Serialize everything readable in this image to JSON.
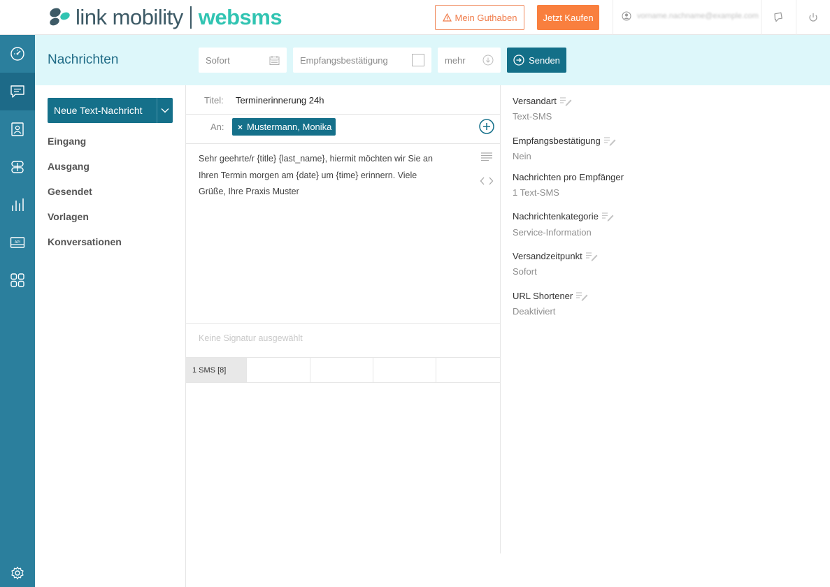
{
  "header": {
    "logo_text": "link mobility",
    "logo_brand": "websms",
    "guthaben_label": "Mein Guthaben",
    "kaufen_label": "Jetzt Kaufen",
    "user_name": "vorname.nachname@example.com"
  },
  "rail": {
    "items": [
      "dashboard-icon",
      "messages-icon",
      "contacts-icon",
      "integrations-icon",
      "statistics-icon",
      "api-icon",
      "apps-icon"
    ],
    "settings_icon": "settings-icon"
  },
  "section": {
    "title": "Nachrichten"
  },
  "toolbar": {
    "schedule_value": "Sofort",
    "receipt_label": "Empfangsbestätigung",
    "more_label": "mehr",
    "send_label": "Senden"
  },
  "sidenav": {
    "new_message_label": "Neue Text-Nachricht",
    "items": [
      "Eingang",
      "Ausgang",
      "Gesendet",
      "Vorlagen",
      "Konversationen"
    ]
  },
  "compose": {
    "title_label": "Titel:",
    "title_value": "Terminerinnerung 24h",
    "to_label": "An:",
    "recipient": "Mustermann, Monika",
    "body_lines": [
      "Sehr geehrte/r {title} {last_name}, hiermit möchten wir Sie an",
      "Ihren Termin morgen am {date} um {time} erinnern. Viele",
      "Grüße, Ihre Praxis Muster"
    ],
    "signature_placeholder": "Keine Signatur ausgewählt",
    "sms_counter": "1 SMS [8]"
  },
  "settings": [
    {
      "label": "Versandart",
      "value": "Text-SMS",
      "editable": true
    },
    {
      "label": "Empfangsbestätigung",
      "value": "Nein",
      "editable": true
    },
    {
      "label": "Nachrichten pro Empfänger",
      "value": "1 Text-SMS",
      "editable": false
    },
    {
      "label": "Nachrichtenkategorie",
      "value": "Service-Information",
      "editable": true
    },
    {
      "label": "Versandzeitpunkt",
      "value": "Sofort",
      "editable": true
    },
    {
      "label": "URL Shortener",
      "value": "Deaktiviert",
      "editable": true
    }
  ],
  "colors": {
    "brand_teal": "#15708a",
    "rail": "#2b7f9d",
    "banner": "#ddf7fa",
    "orange": "#f97f3e",
    "logo_green": "#31c4b2"
  }
}
